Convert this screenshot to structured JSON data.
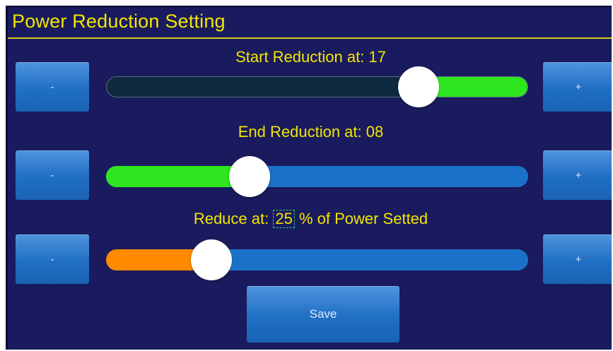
{
  "window": {
    "title": "Power Reduction Setting"
  },
  "colors": {
    "background": "#1a1a5e",
    "accent_text": "#f2e600",
    "button": "#1f6fc4",
    "track_blue": "#1a72c8",
    "track_dark": "#0e2940",
    "fill_green": "#2ee61f",
    "fill_orange": "#ff8a00"
  },
  "start": {
    "label": "Start Reduction at: 17",
    "fraction": 0.74,
    "minus": "-",
    "plus": "+"
  },
  "end": {
    "label": "End Reduction at: 08",
    "fraction": 0.34,
    "minus": "-",
    "plus": "+"
  },
  "reduce": {
    "prefix": "Reduce at: ",
    "value": "25",
    "suffix": " % of Power Setted",
    "fraction": 0.25,
    "minus": "-",
    "plus": "+"
  },
  "save_label": "Save"
}
